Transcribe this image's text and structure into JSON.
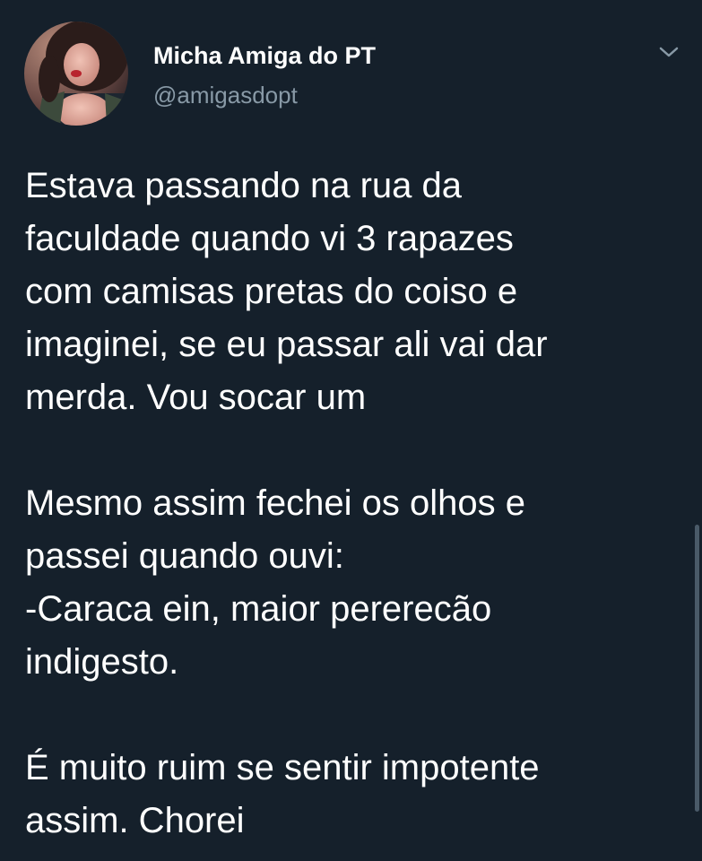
{
  "author": {
    "display_name": "Micha Amiga do PT",
    "handle": "@amigasdopt",
    "avatar": "profile-photo"
  },
  "menu": {
    "icon": "chevron-down-icon"
  },
  "tweet": {
    "paragraphs": [
      {
        "lines": [
          "Estava passando na rua da",
          "faculdade quando vi 3 rapazes",
          "com camisas pretas do coiso e",
          "imaginei, se eu passar ali vai dar",
          "merda. Vou socar um"
        ]
      },
      {
        "lines": [
          "Mesmo assim fechei os olhos e",
          "passei quando ouvi:",
          "-Caraca ein, maior pererecão",
          "indigesto."
        ]
      },
      {
        "lines": [
          "É muito ruim se sentir impotente",
          "assim. Chorei"
        ]
      }
    ]
  },
  "colors": {
    "background": "#15202b",
    "text": "#ffffff",
    "secondary_text": "#8899a6"
  }
}
